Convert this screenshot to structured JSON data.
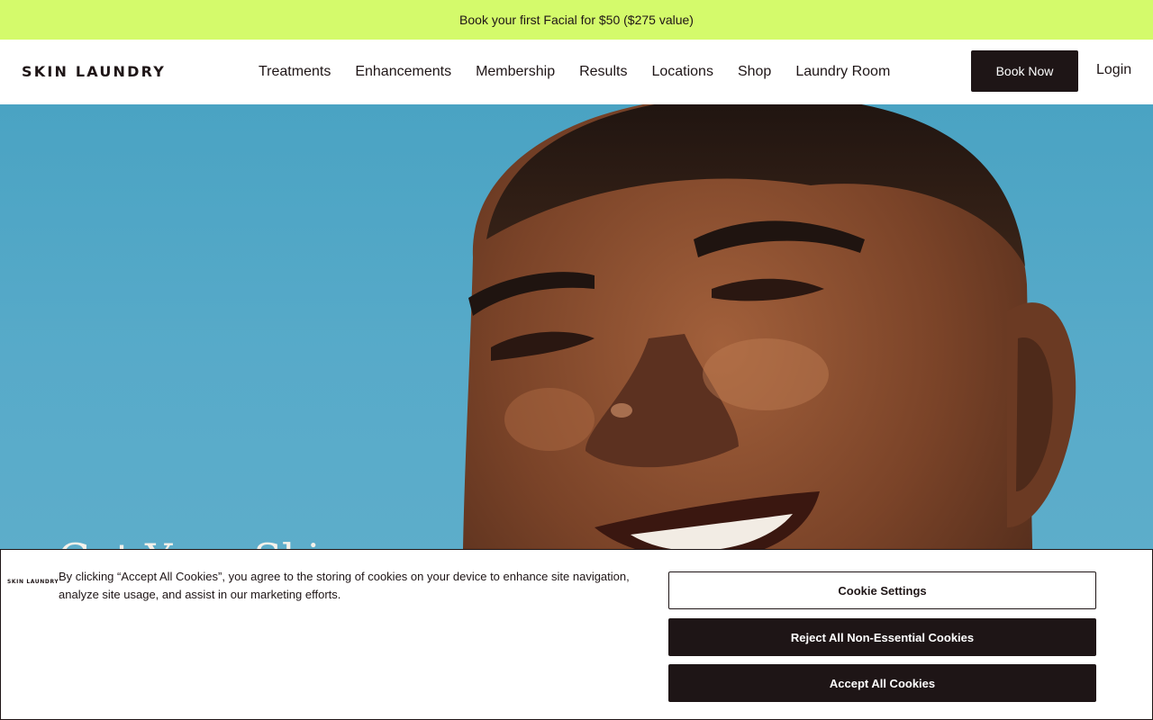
{
  "promo": {
    "text": "Book your first Facial for $50 ($275 value)"
  },
  "header": {
    "logo": "SKIN LAUNDRY",
    "nav": [
      "Treatments",
      "Enhancements",
      "Membership",
      "Results",
      "Locations",
      "Shop",
      "Laundry Room"
    ],
    "book_label": "Book Now",
    "login_label": "Login"
  },
  "hero": {
    "headline": "Get Your Skin"
  },
  "cookie": {
    "logo": "SKIN LAUNDRY",
    "text": "By clicking “Accept All Cookies”, you agree to the storing of cookies on your device to enhance site navigation, analyze site usage, and assist in our marketing efforts.",
    "settings_label": "Cookie Settings",
    "reject_label": "Reject All Non-Essential Cookies",
    "accept_label": "Accept All Cookies"
  },
  "colors": {
    "promo_bg": "#d4fa6b",
    "brand_dark": "#1e1516",
    "sky_blue": "#57aac9"
  }
}
